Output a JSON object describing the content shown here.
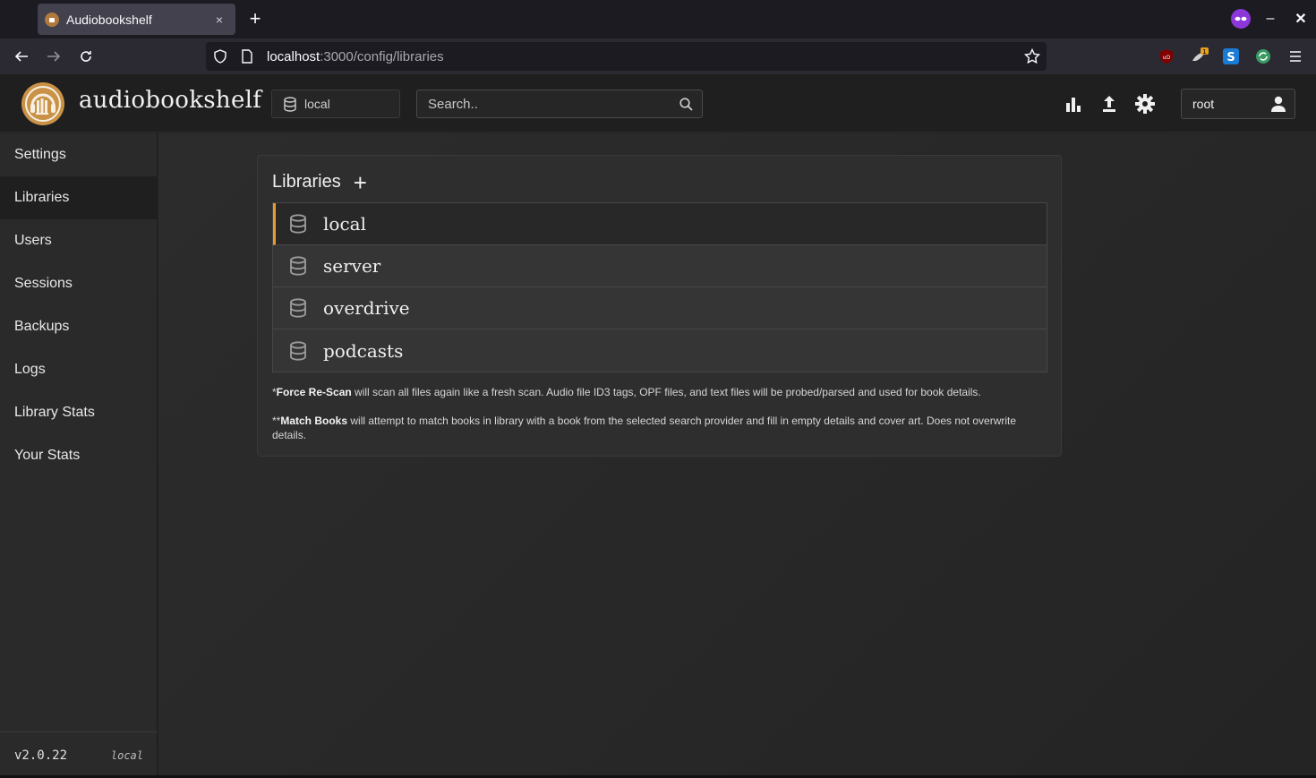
{
  "browser": {
    "tab_title": "Audiobookshelf",
    "tab_close": "×",
    "new_tab": "+",
    "url_host": "localhost",
    "url_rest": ":3000/config/libraries",
    "minimize": "–",
    "close": "✕",
    "extension_badge": "1"
  },
  "app": {
    "brand": "audiobookshelf",
    "library_selector": "local",
    "search_placeholder": "Search..",
    "user": "root"
  },
  "sidebar": {
    "items": [
      {
        "label": "Settings"
      },
      {
        "label": "Libraries"
      },
      {
        "label": "Users"
      },
      {
        "label": "Sessions"
      },
      {
        "label": "Backups"
      },
      {
        "label": "Logs"
      },
      {
        "label": "Library Stats"
      },
      {
        "label": "Your Stats"
      }
    ],
    "active": "Libraries",
    "version": "v2.0.22",
    "env": "local"
  },
  "main": {
    "title": "Libraries",
    "add": "+",
    "libraries": [
      {
        "name": "local"
      },
      {
        "name": "server"
      },
      {
        "name": "overdrive"
      },
      {
        "name": "podcasts"
      }
    ],
    "notes": [
      {
        "prefix": "*",
        "bold": "Force Re-Scan",
        "text": " will scan all files again like a fresh scan. Audio file ID3 tags, OPF files, and text files will be probed/parsed and used for book details."
      },
      {
        "prefix": "**",
        "bold": "Match Books",
        "text": " will attempt to match books in library with a book from the selected search provider and fill in empty details and cover art. Does not overwrite details."
      }
    ]
  },
  "colors": {
    "accent": "#e89a2c",
    "logo": "#c99247"
  }
}
